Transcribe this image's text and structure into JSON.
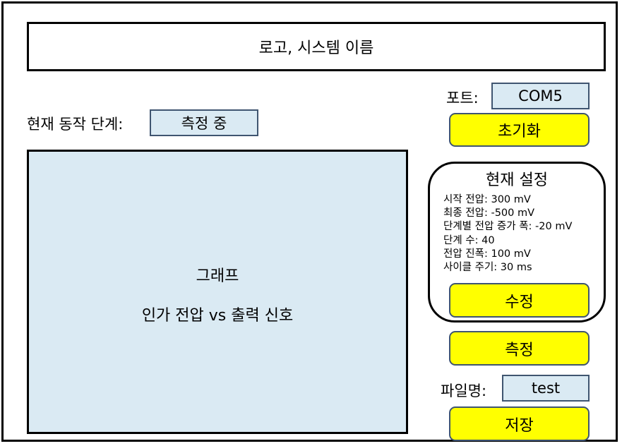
{
  "header": {
    "title": "로고, 시스템 이름"
  },
  "status": {
    "label": "현재 동작 단계:",
    "value": "측정 중"
  },
  "port": {
    "label": "포트:",
    "value": "COM5"
  },
  "buttons": {
    "init": "초기화",
    "edit": "수정",
    "measure": "측정",
    "save": "저장"
  },
  "graph": {
    "title": "그래프",
    "subtitle": "인가 전압 vs 출력 신호"
  },
  "settings": {
    "title": "현재 설정",
    "lines": [
      "시작 전압: 300 mV",
      "최종 전압: -500 mV",
      "단계별 전압 증가 폭: -20 mV",
      "단계 수: 40",
      "전압 진폭: 100 mV",
      "사이클 주기: 30 ms"
    ]
  },
  "file": {
    "label": "파일명:",
    "value": "test"
  },
  "colors": {
    "button_fill": "#ffff00",
    "field_fill": "#daeaf3",
    "border_dark": "#3f5570"
  }
}
